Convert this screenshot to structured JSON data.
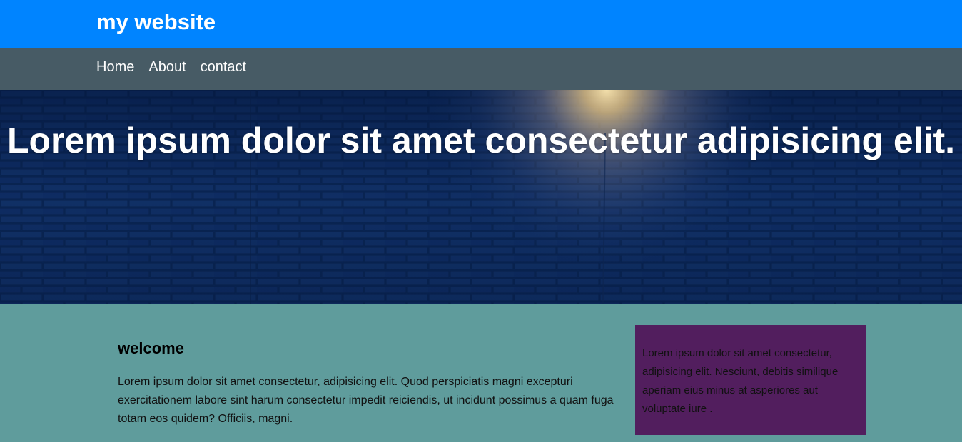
{
  "header": {
    "site_title": "my website",
    "background_color": "#0084ff"
  },
  "nav": {
    "items": [
      {
        "label": "Home"
      },
      {
        "label": "About"
      },
      {
        "label": "contact"
      }
    ],
    "background_color": "#475b65"
  },
  "hero": {
    "title": "Lorem ipsum dolor sit amet consectetur adipisicing elit.",
    "background": "dark blue brick wall lit by a wall lamp"
  },
  "content": {
    "background_color": "#5f9c9c",
    "main": {
      "heading": "welcome",
      "text": "Lorem ipsum dolor sit amet consectetur, adipisicing elit. Quod perspiciatis magni excepturi exercitationem labore sint harum consectetur impedit reiciendis, ut incidunt possimus a quam fuga totam eos quidem? Officiis, magni."
    },
    "aside": {
      "text": "Lorem ipsum dolor sit amet consectetur, adipisicing elit. Nesciunt, debitis similique aperiam eius minus at asperiores aut voluptate iure .",
      "background_color": "#521e5e"
    }
  }
}
